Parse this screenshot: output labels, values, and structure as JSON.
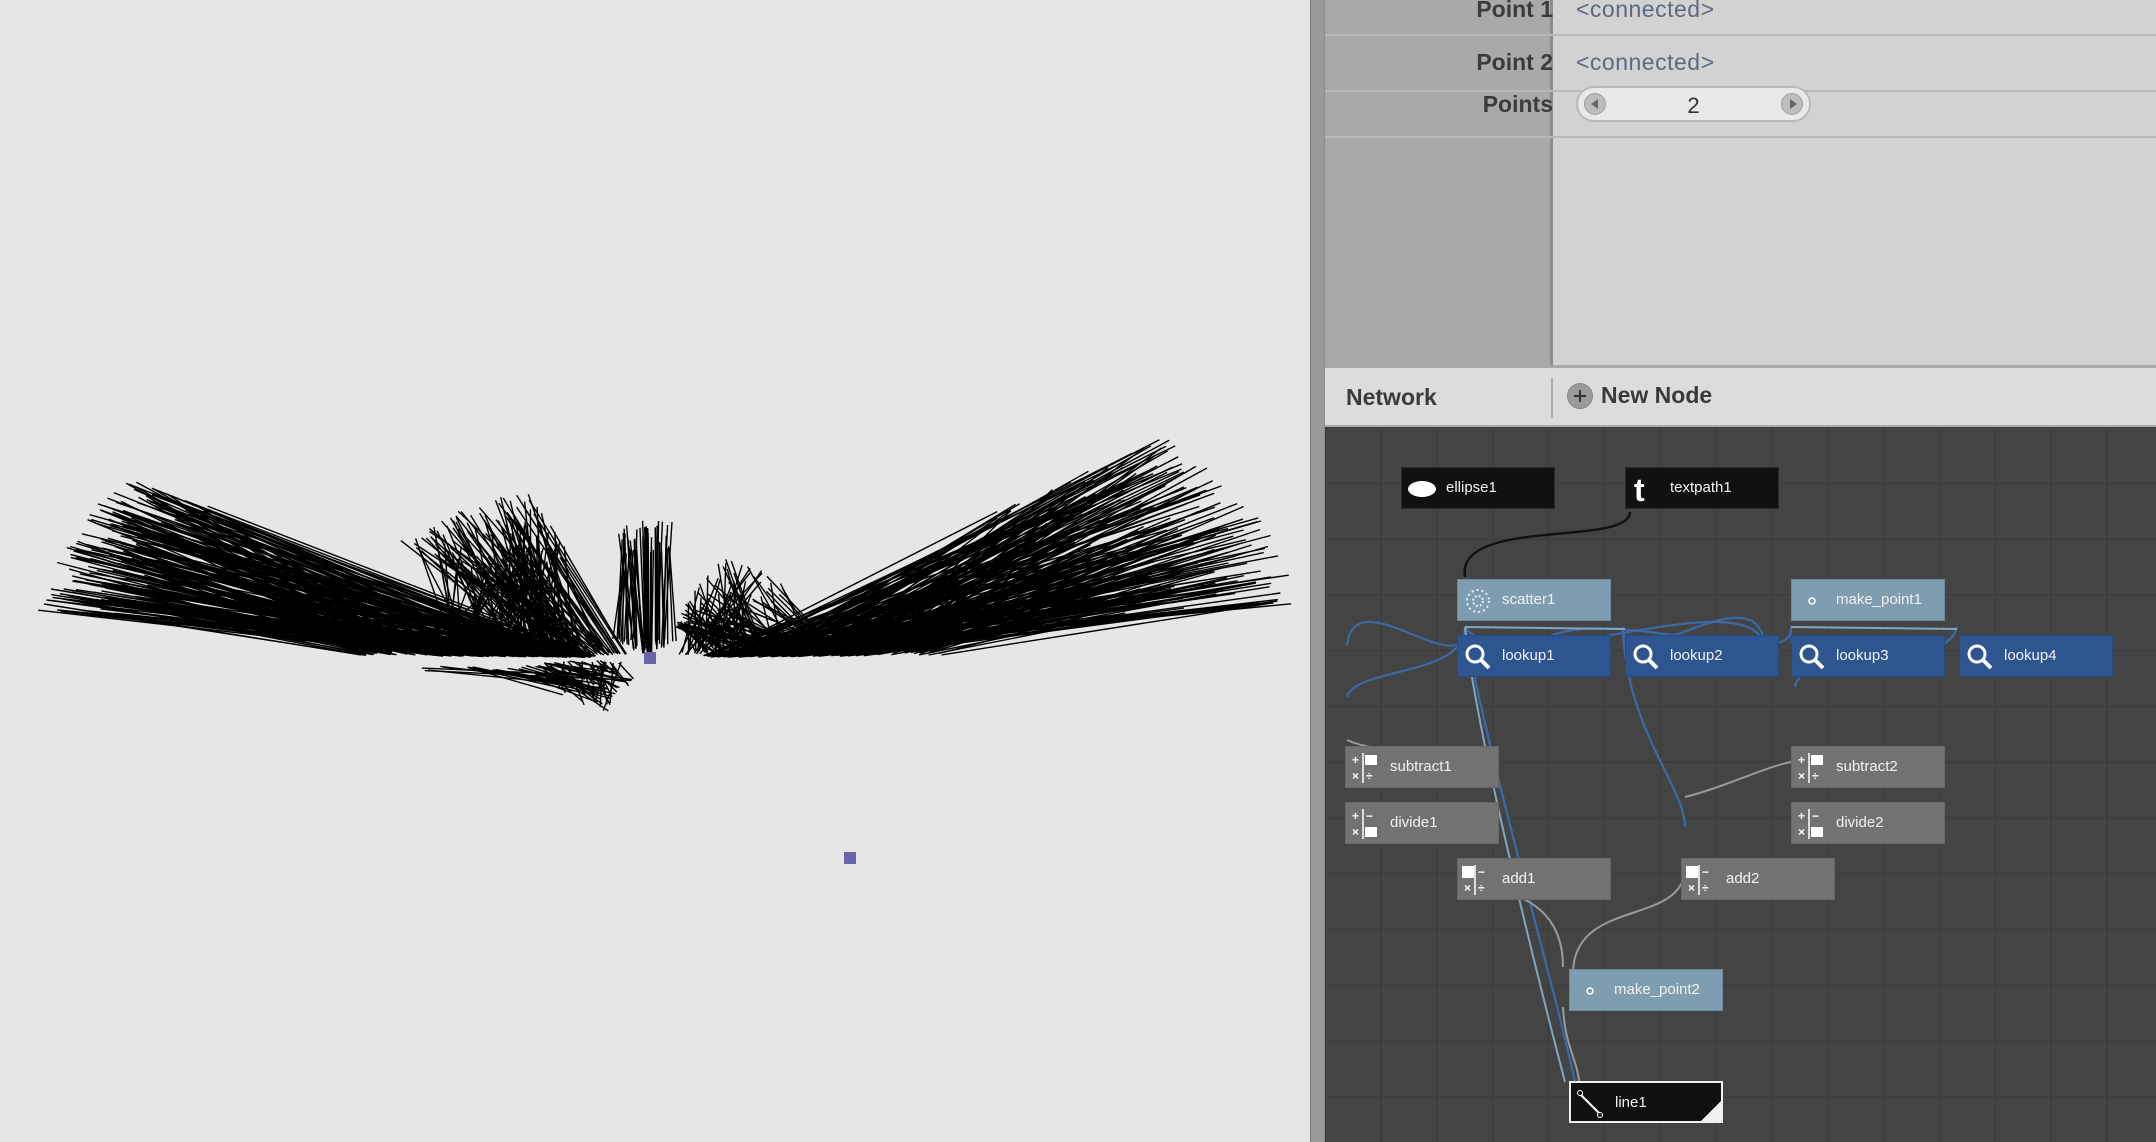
{
  "params": {
    "rows": [
      {
        "label": "Point 1",
        "value": "<connected>"
      },
      {
        "label": "Point 2",
        "value": "<connected>"
      },
      {
        "label": "Points",
        "value": "2"
      }
    ]
  },
  "network": {
    "title": "Network",
    "new_node_label": "New Node",
    "nodes": {
      "ellipse1": "ellipse1",
      "textpath1": "textpath1",
      "scatter1": "scatter1",
      "make_point1": "make_point1",
      "lookup1": "lookup1",
      "lookup2": "lookup2",
      "lookup3": "lookup3",
      "lookup4": "lookup4",
      "subtract1": "subtract1",
      "subtract2": "subtract2",
      "divide1": "divide1",
      "divide2": "divide2",
      "add1": "add1",
      "add2": "add2",
      "make_point2": "make_point2",
      "line1": "line1"
    },
    "colors": {
      "generator": "#111111",
      "scatter": "#7e9db0",
      "lookup": "#2e5590",
      "math": "#727272",
      "wire_blue": "#3a6aa8",
      "wire_gray": "#9a9a9a"
    }
  },
  "viewer": {
    "stroke_color": "#000000",
    "handle_color": "#6a64a8"
  }
}
